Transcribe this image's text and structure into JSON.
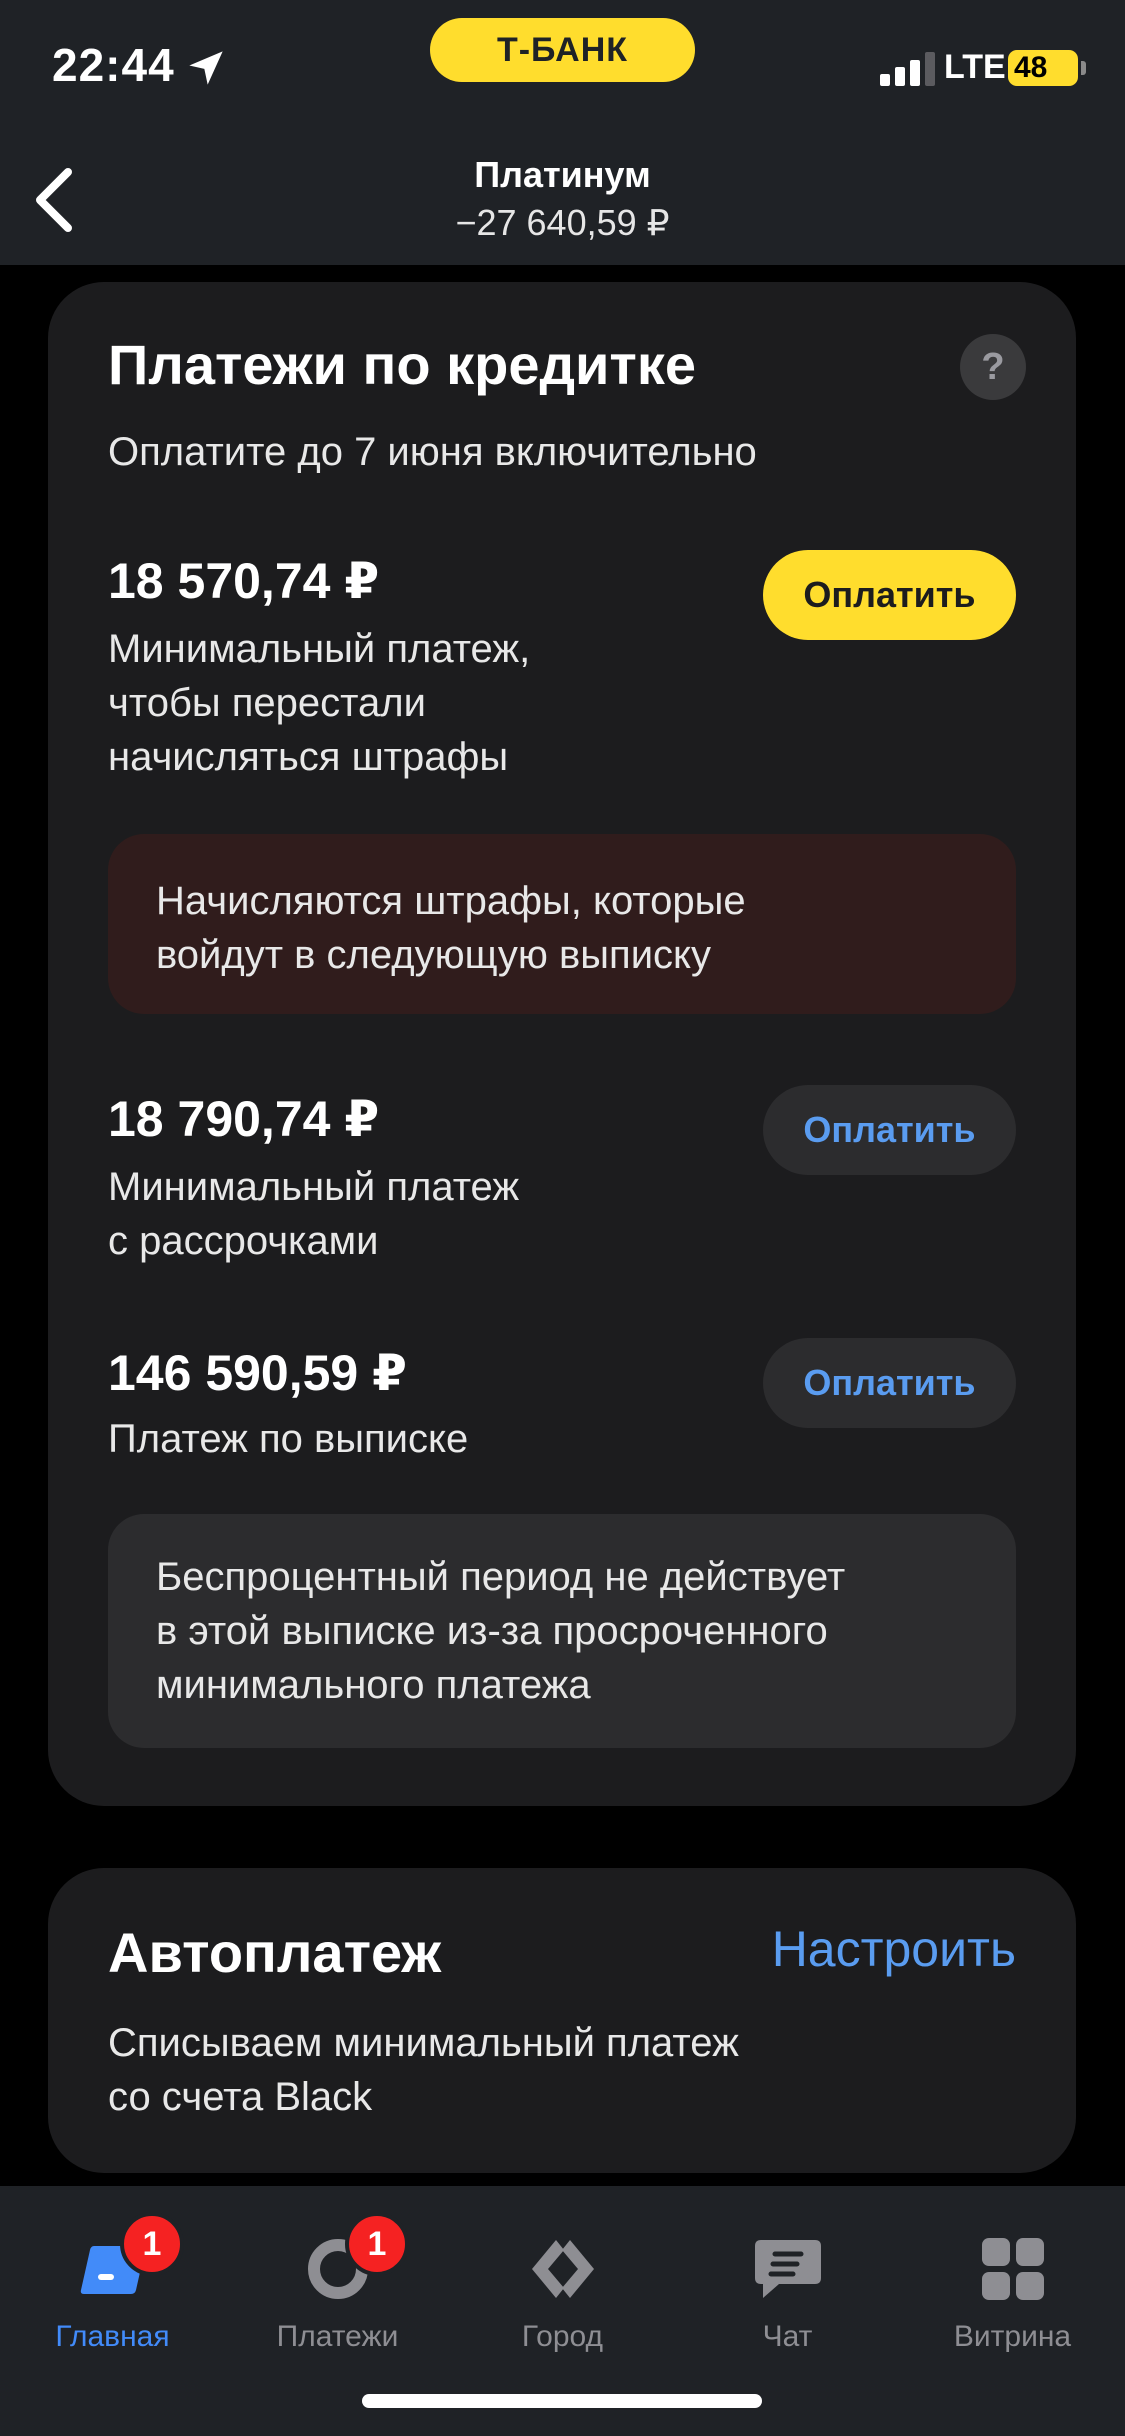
{
  "status_bar": {
    "time": "22:44",
    "network": "LTE",
    "battery": "48",
    "bank_name": "Т-БАНК"
  },
  "header": {
    "title": "Платинум",
    "balance": "−27 640,59 ₽"
  },
  "payments_card": {
    "title": "Платежи по кредитке",
    "help": "?",
    "subtitle": "Оплатите до 7 июня включительно",
    "items": [
      {
        "amount": "18 570,74 ₽",
        "desc_lines": [
          "Минимальный платеж,",
          "чтобы перестали",
          "начисляться штрафы"
        ],
        "button": "Оплатить"
      },
      {
        "amount": "18 790,74 ₽",
        "desc_lines": [
          "Минимальный платеж",
          "с рассрочками"
        ],
        "button": "Оплатить"
      },
      {
        "amount": "146 590,59 ₽",
        "desc_lines": [
          "Платеж по выписке"
        ],
        "button": "Оплатить"
      }
    ],
    "penalty_notice_lines": [
      "Начисляются штрафы, которые",
      "войдут в следующую выписку"
    ],
    "grace_notice_lines": [
      "Беспроцентный период не действует",
      "в этой выписке из-за просроченного",
      "минимального платежа"
    ]
  },
  "autopay_card": {
    "title": "Автоплатеж",
    "link": "Настроить",
    "desc_lines": [
      "Списываем минимальный платеж",
      "со счета Black"
    ]
  },
  "tab_bar": {
    "tabs": [
      {
        "label": "Главная",
        "icon": "card-icon",
        "badge": "1",
        "active": true
      },
      {
        "label": "Платежи",
        "icon": "ring-icon",
        "badge": "1",
        "active": false
      },
      {
        "label": "Город",
        "icon": "diamond-icon",
        "active": false
      },
      {
        "label": "Чат",
        "icon": "chat-icon",
        "active": false
      },
      {
        "label": "Витрина",
        "icon": "grid-icon",
        "active": false
      }
    ]
  },
  "colors": {
    "accent_yellow": "#ffdd2d",
    "link_blue": "#5a9cf0",
    "badge_red": "#f52222",
    "surface": "#1c1c1e"
  }
}
